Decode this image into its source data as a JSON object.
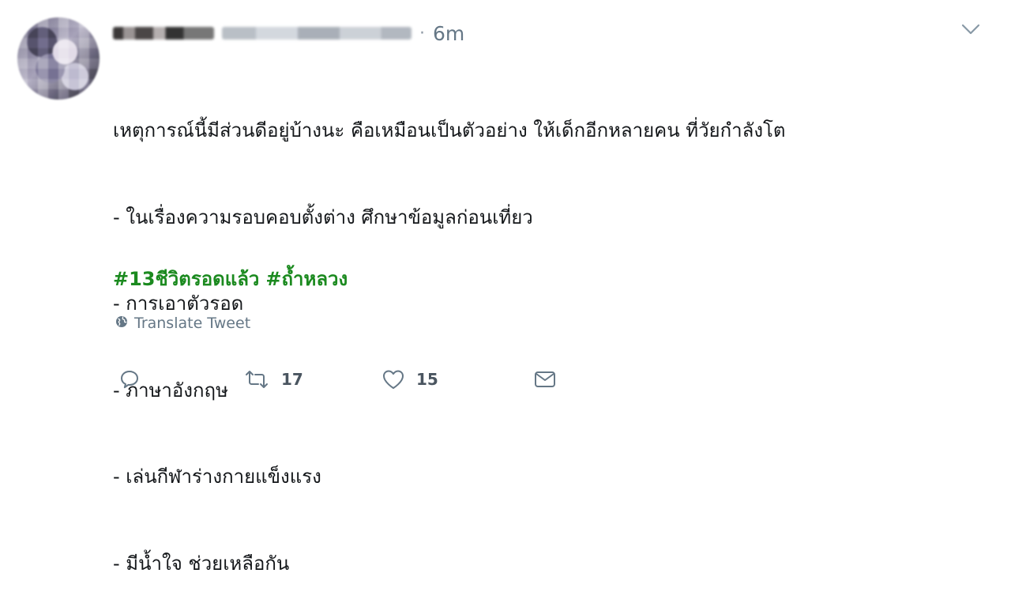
{
  "tweet": {
    "time": "6m",
    "separator": "·",
    "text_lines": [
      "เหตุการณ์นี้มีส่วนดีอยู่บ้างนะ คือเหมือนเป็นตัวอย่าง ให้เด็กอีกหลายคน ที่วัยกำลังโต",
      "- ในเรื่องความรอบคอบตั้งต่าง ศึกษาข้อมูลก่อนเที่ยว",
      "- การเอาตัวรอด",
      "- ภาษาอังกฤษ",
      "- เล่นกีฬาร่างกายแข็งแรง",
      "- มีน้ำใจ ช่วยเหลือกัน"
    ],
    "hashtags": [
      "#13ชีวิตรอดแล้ว",
      "#ถ้ำหลวง"
    ],
    "translate_label": "Translate Tweet",
    "retweet_count": "17",
    "like_count": "15"
  },
  "icons": {
    "caret": "chevron-down-icon",
    "globe": "globe-icon",
    "reply": "reply-icon",
    "retweet": "retweet-icon",
    "like": "heart-icon",
    "dm": "envelope-icon"
  },
  "colors": {
    "hashtag": "#1b8a1f",
    "muted": "#657786",
    "text": "#14171a"
  }
}
